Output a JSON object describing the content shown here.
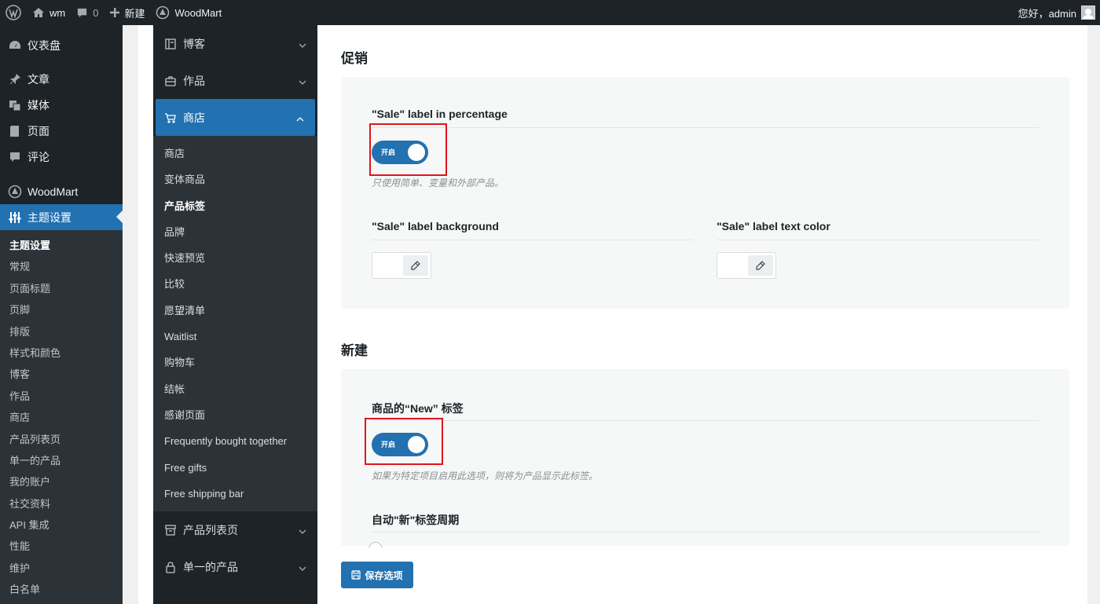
{
  "adminbar": {
    "site_name": "wm",
    "comments_count": "0",
    "new_label": "新建",
    "theme_link": "WoodMart",
    "greeting": "您好，admin"
  },
  "wp_sidebar": {
    "menu": [
      {
        "label": "仪表盘",
        "icon": "dashboard-icon"
      },
      {
        "label": "文章",
        "icon": "pin-icon"
      },
      {
        "label": "媒体",
        "icon": "media-icon"
      },
      {
        "label": "页面",
        "icon": "page-icon"
      },
      {
        "label": "评论",
        "icon": "comment-icon"
      },
      {
        "label": "WoodMart",
        "icon": "woodmart-icon"
      },
      {
        "label": "主题设置",
        "icon": "sliders-icon"
      }
    ],
    "submenu": [
      "主题设置",
      "常规",
      "页面标题",
      "页脚",
      "排版",
      "样式和颜色",
      "博客",
      "作品",
      "商店",
      "产品列表页",
      "单一的产品",
      "我的账户",
      "社交资料",
      "API 集成",
      "性能",
      "维护",
      "白名单"
    ]
  },
  "options_nav": {
    "items_top": [
      {
        "label": "博客",
        "icon": "blog-icon"
      },
      {
        "label": "作品",
        "icon": "briefcase-icon"
      }
    ],
    "active": {
      "label": "商店",
      "icon": "cart-icon"
    },
    "subitems": [
      "商店",
      "变体商品",
      "产品标签",
      "品牌",
      "快速预览",
      "比较",
      "愿望清单",
      "Waitlist",
      "购物车",
      "结帐",
      "感谢页面",
      "Frequently bought together",
      "Free gifts",
      "Free shipping bar"
    ],
    "items_bottom": [
      {
        "label": "产品列表页",
        "icon": "archive-icon"
      },
      {
        "label": "单一的产品",
        "icon": "lock-icon"
      }
    ]
  },
  "content": {
    "sale_section_title": "促销",
    "sale_percentage_title": "\"Sale\" label in percentage",
    "sale_percentage_toggle": "开启",
    "sale_percentage_hint": "只使用简单、变量和外部产品。",
    "sale_bg_title": "\"Sale\" label background",
    "sale_text_color_title": "\"Sale\" label text color",
    "new_section_title": "新建",
    "new_label_title": "商品的“New” 标签",
    "new_label_toggle": "开启",
    "new_label_hint": "如果为特定项目启用此选项，则将为产品显示此标签。",
    "new_period_title": "自动\"新\"标签周期",
    "save_button": "保存选项"
  },
  "colors": {
    "accent": "#2271b1",
    "dark_bg": "#1d2327",
    "highlight_border": "#e0141e"
  }
}
